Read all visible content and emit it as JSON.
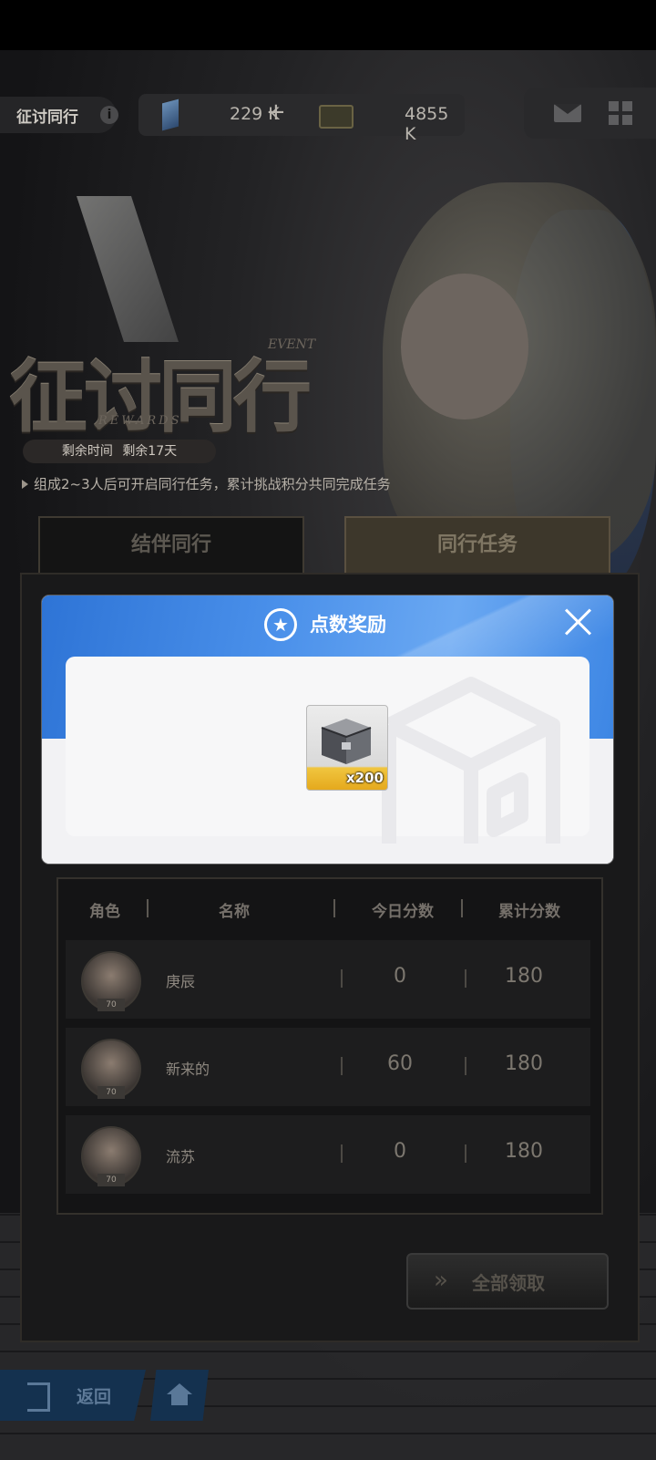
{
  "header": {
    "event_name": "征讨同行",
    "info_glyph": "i",
    "currency": [
      {
        "icon": "crystal-icon",
        "value": "229 K",
        "plus": "+"
      },
      {
        "icon": "ticket-icon",
        "value": "4855 K"
      }
    ],
    "right_icons": [
      "mail-icon",
      "grid-menu-icon"
    ]
  },
  "banner": {
    "title": "征讨同行",
    "event_word": "EVENT",
    "rewards_word": "REWARDS",
    "time_label": "剩余时间",
    "time_value": "剩余17天",
    "description": "组成2~3人后可开启同行任务，累计挑战积分共同完成任务"
  },
  "tabs": [
    {
      "label": "结伴同行",
      "active": false
    },
    {
      "label": "同行任务",
      "active": true
    }
  ],
  "table": {
    "headers": [
      "角色",
      "名称",
      "今日分数",
      "累计分数"
    ],
    "rows": [
      {
        "level": "70",
        "name": "庚辰",
        "today": "0",
        "total": "180"
      },
      {
        "level": "70",
        "name": "新来的",
        "today": "60",
        "total": "180"
      },
      {
        "level": "70",
        "name": "流苏",
        "today": "0",
        "total": "180"
      }
    ]
  },
  "claim_all_label": "全部领取",
  "bottom_nav": {
    "back_label": "返回",
    "home_icon": "home-icon"
  },
  "modal": {
    "title": "点数奖励",
    "item": {
      "icon": "crate-icon",
      "quantity": "x200"
    },
    "colors": {
      "band": "#3d86e4",
      "card": "#f7f7f8",
      "tile_accent": "#e5a91d"
    }
  }
}
